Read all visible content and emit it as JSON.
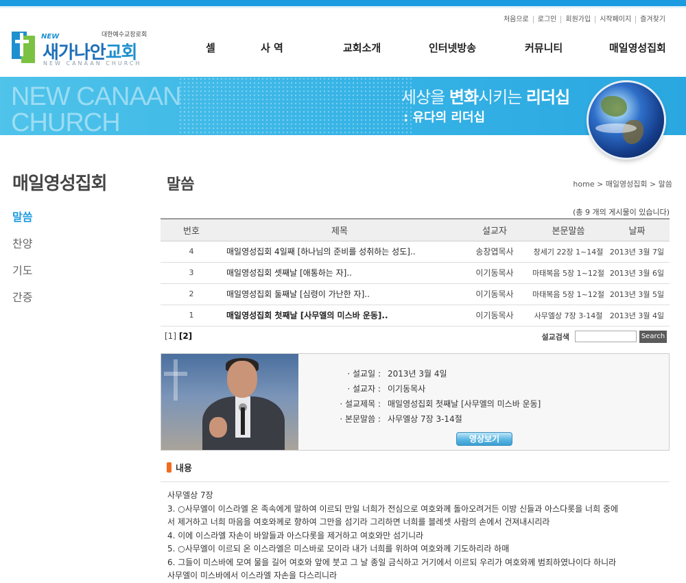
{
  "util_links": [
    "처음으로",
    "로그인",
    "회원가입",
    "시작페이지",
    "즐겨찾기"
  ],
  "logo": {
    "new": "NEW",
    "denomination": "대한예수교장로회",
    "name_a": "새가나안",
    "name_b": "교회",
    "english": "NEW CANAAN CHURCH"
  },
  "gnb": [
    "셀",
    "사 역",
    "교회소개",
    "인터넷방송",
    "커뮤니티",
    "매일영성집회"
  ],
  "banner": {
    "big_line1": "NEW CANAAN",
    "big_line2": "CHURCH",
    "slogan_a": "세상을 ",
    "slogan_b": "변화",
    "slogan_c": "시키는 ",
    "slogan_d": "리더십",
    "slogan2": ": 유다의 리더십"
  },
  "lnb": {
    "title": "매일영성집회",
    "items": [
      "말씀",
      "찬양",
      "기도",
      "간증"
    ]
  },
  "page": {
    "title": "말씀",
    "breadcrumb": "home > 매일영성집회 > 말씀",
    "total_text": "(총 9 개의 게시물이 있습니다)"
  },
  "table": {
    "headers": [
      "번호",
      "제목",
      "설교자",
      "본문말씀",
      "날짜"
    ],
    "rows": [
      {
        "num": "4",
        "title": "매일영성집회 4일째 [하나님의 준비를 성취하는 성도]..",
        "preacher": "송창엽목사",
        "verse": "창세기 22장 1~14절",
        "date": "2013년 3월 7일"
      },
      {
        "num": "3",
        "title": "매일영성집회 셋째날 [애통하는 자]..",
        "preacher": "이기동목사",
        "verse": "마태복음 5장 1~12절",
        "date": "2013년 3월 6일"
      },
      {
        "num": "2",
        "title": "매일영성집회 둘째날 [심령이 가난한 자]..",
        "preacher": "이기동목사",
        "verse": "마태복음 5장 1~12절",
        "date": "2013년 3월 5일"
      },
      {
        "num": "1",
        "title": "매일영성집회 첫째날 [사무엘의 미스바 운동]..",
        "preacher": "이기동목사",
        "verse": "사무엘상 7장 3-14절",
        "date": "2013년 3월 4일"
      }
    ]
  },
  "paging": {
    "p1": "[1]",
    "p2": "[2]"
  },
  "search": {
    "label": "설교검색",
    "placeholder": "",
    "button": "Search"
  },
  "detail": {
    "rows": [
      {
        "label": "· 설교일 :",
        "value": "2013년 3월 4일"
      },
      {
        "label": "· 설교자 :",
        "value": "이기동목사"
      },
      {
        "label": "· 설교제목 :",
        "value": "매일영성집회 첫째날 [사무엘의 미스바 운동]"
      },
      {
        "label": "· 본문말씀 :",
        "value": "사무엘상 7장 3-14절"
      }
    ],
    "video_button": "영상보기"
  },
  "content": {
    "heading": "내용",
    "lines": [
      "사무엘상 7장",
      "3. ○사무엘이 이스라엘 온 족속에게 말하여 이르되 만일 너희가 전심으로 여호와께 돌아오려거든 이방 신들과 아스다롯을 너희 중에",
      "서 제거하고 너희 마음을 여호와께로 향하여 그만을 섬기라 그리하면 너희를 블레셋 사람의 손에서 건져내시리라",
      "4. 이에 이스라엘 자손이 바알들과 아스다롯을 제거하고 여호와만 섬기니라",
      "5. ○사무엘이 이르되 온 이스라엘은 미스바로 모이라 내가 너희를 위하여 여호와께 기도하리라 하매",
      "6. 그들이 미스바에 모여 물을 길어 여호와 앞에 붓고 그 날 종일 금식하고 거기에서 이르되 우리가 여호와께 범죄하였나이다 하니라",
      "사무엘이 미스바에서 이스라엘 자손을 다스리니라"
    ]
  },
  "colors": {
    "accent": "#1b9be0",
    "orange_mark": "#f26c1d"
  }
}
